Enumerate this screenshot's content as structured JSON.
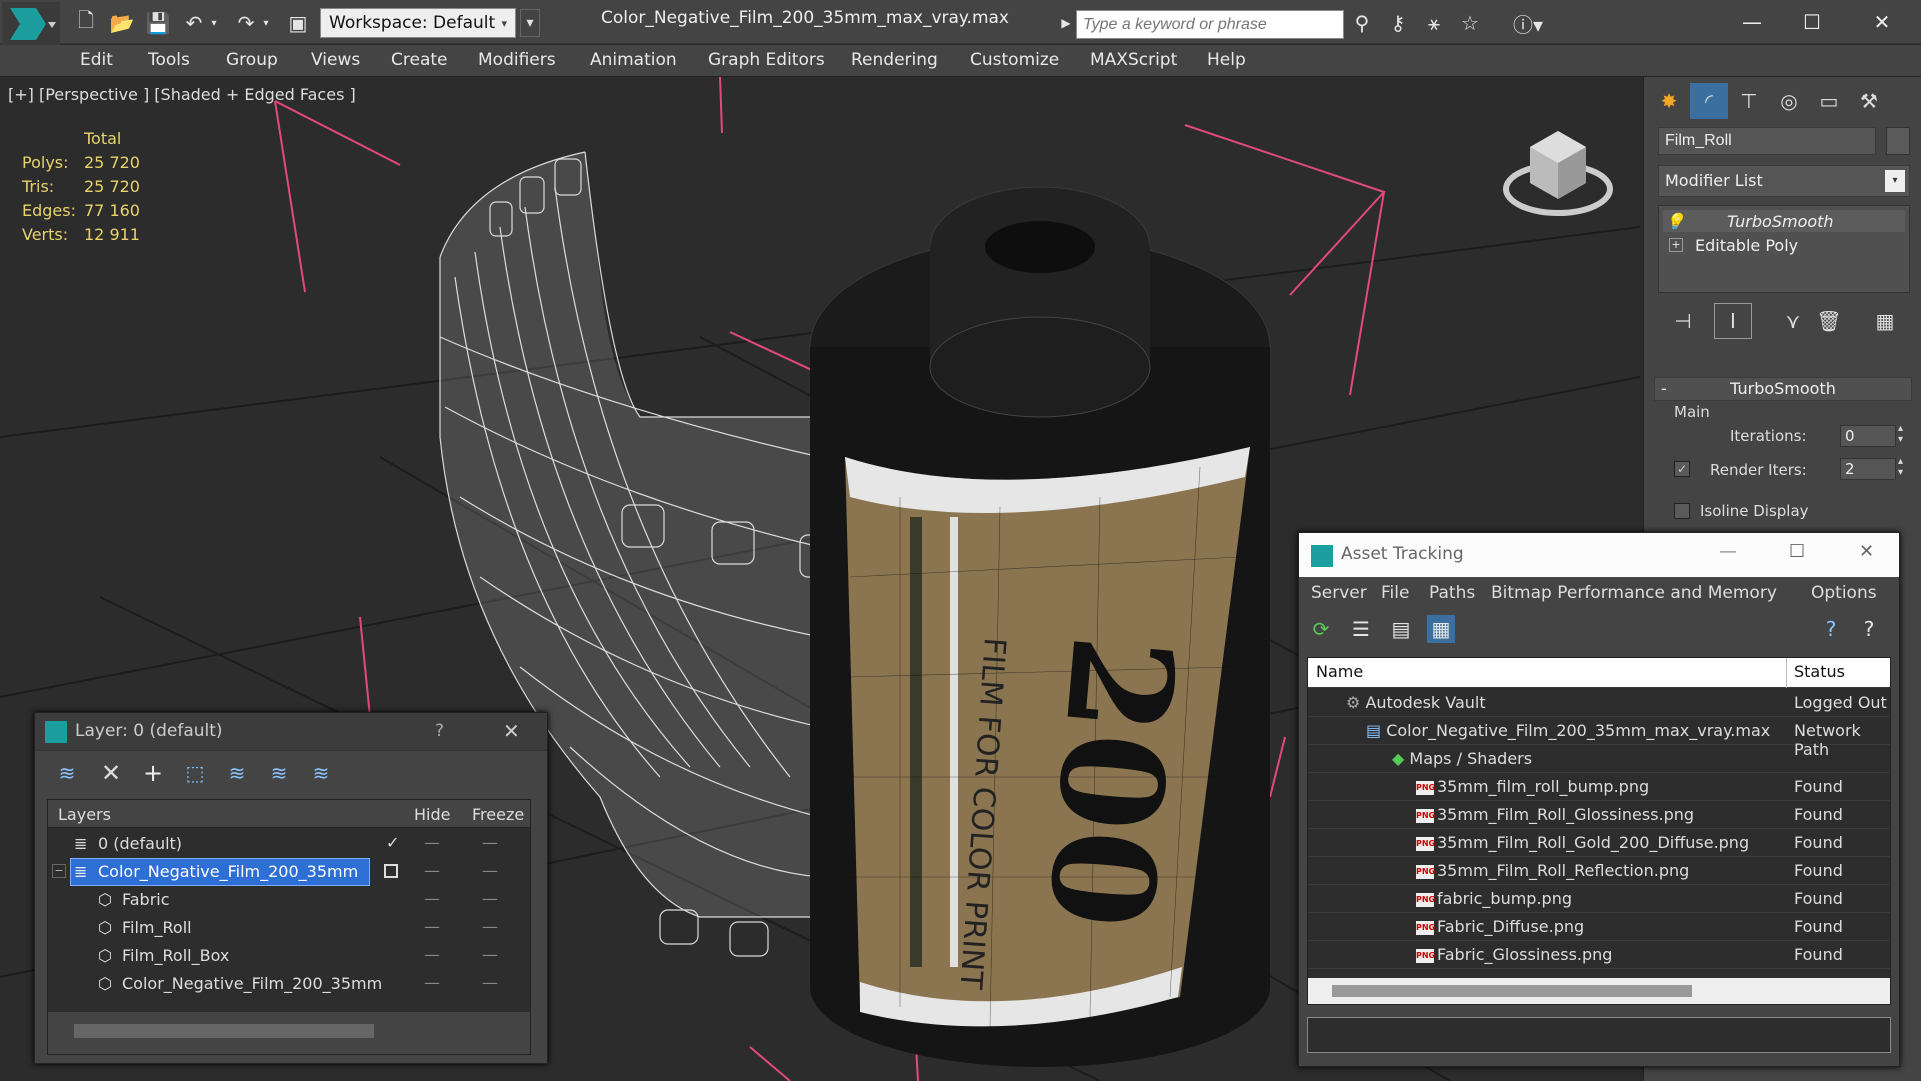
{
  "app": {
    "title": "Color_Negative_Film_200_35mm_max_vray.max",
    "workspace": "Workspace: Default",
    "search_placeholder": "Type a keyword or phrase"
  },
  "menu": [
    "Edit",
    "Tools",
    "Group",
    "Views",
    "Create",
    "Modifiers",
    "Animation",
    "Graph Editors",
    "Rendering",
    "Customize",
    "MAXScript",
    "Help"
  ],
  "viewport": {
    "label": "[+] [Perspective ] [Shaded + Edged Faces ]",
    "stats": {
      "header": "Total",
      "rows": [
        {
          "label": "Polys:",
          "value": "25 720"
        },
        {
          "label": "Tris:",
          "value": "25 720"
        },
        {
          "label": "Edges:",
          "value": "77 160"
        },
        {
          "label": "Verts:",
          "value": "12 911"
        }
      ]
    },
    "canister_number": "200",
    "canister_text": "FILM FOR COLOR PRINT"
  },
  "command_panel": {
    "object_name": "Film_Roll",
    "modifier_list": "Modifier List",
    "stack": [
      "TurboSmooth",
      "Editable Poly"
    ],
    "rollout": {
      "title": "TurboSmooth",
      "group": "Main",
      "iterations_label": "Iterations:",
      "iterations": "0",
      "render_iters_label": "Render Iters:",
      "render_iters": "2",
      "isoline_label": "Isoline Display",
      "minus": "-"
    }
  },
  "layer_window": {
    "title": "Layer: 0 (default)",
    "help": "?",
    "columns": {
      "layers": "Layers",
      "hide": "Hide",
      "freeze": "Freeze"
    },
    "rows": [
      {
        "name": "0 (default)",
        "indent": 0
      },
      {
        "name": "Color_Negative_Film_200_35mm",
        "indent": 0,
        "selected": true
      },
      {
        "name": "Fabric",
        "indent": 1
      },
      {
        "name": "Film_Roll",
        "indent": 1
      },
      {
        "name": "Film_Roll_Box",
        "indent": 1
      },
      {
        "name": "Color_Negative_Film_200_35mm",
        "indent": 1
      }
    ]
  },
  "asset_window": {
    "title": "Asset Tracking",
    "menu": [
      "Server",
      "File",
      "Paths",
      "Bitmap Performance and Memory",
      "Options"
    ],
    "columns": {
      "name": "Name",
      "status": "Status"
    },
    "rows": [
      {
        "name": "Autodesk Vault",
        "status": "Logged Out",
        "indent": 1
      },
      {
        "name": "Color_Negative_Film_200_35mm_max_vray.max",
        "status": "Network Path",
        "indent": 2
      },
      {
        "name": "Maps / Shaders",
        "status": "",
        "indent": 3
      },
      {
        "name": "35mm_film_roll_bump.png",
        "status": "Found",
        "indent": 4
      },
      {
        "name": "35mm_Film_Roll_Glossiness.png",
        "status": "Found",
        "indent": 4
      },
      {
        "name": "35mm_Film_Roll_Gold_200_Diffuse.png",
        "status": "Found",
        "indent": 4
      },
      {
        "name": "35mm_Film_Roll_Reflection.png",
        "status": "Found",
        "indent": 4
      },
      {
        "name": "fabric_bump.png",
        "status": "Found",
        "indent": 4
      },
      {
        "name": "Fabric_Diffuse.png",
        "status": "Found",
        "indent": 4
      },
      {
        "name": "Fabric_Glossiness.png",
        "status": "Found",
        "indent": 4
      }
    ],
    "png_badge": "PNG"
  }
}
